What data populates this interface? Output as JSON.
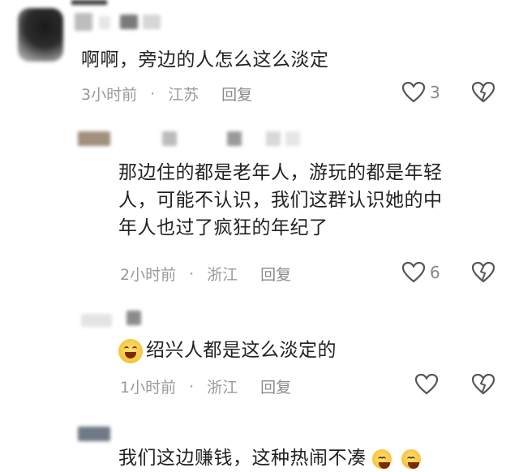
{
  "comments": [
    {
      "text": "啊啊，旁边的人怎么这么淡定",
      "time": "3小时前",
      "location": "江苏",
      "reply": "回复",
      "likes": "3"
    },
    {
      "lines": [
        "那边住的都是老年人，游玩的都是年轻",
        "人，可能不认识，我们这群认识她的中",
        "年人也过了疯狂的年纪了"
      ],
      "time": "2小时前",
      "location": "浙江",
      "reply": "回复",
      "likes": "6"
    },
    {
      "emoji": "laughing-sweat-emoji",
      "text": "绍兴人都是这么淡定的",
      "time": "1小时前",
      "location": "浙江",
      "reply": "回复",
      "likes": ""
    },
    {
      "text_partial": "我们这边赚钱，这种热闹不凑"
    }
  ],
  "separator": "·",
  "colors": {
    "text": "#222222",
    "meta": "#9a9a9a",
    "icon": "#555555"
  },
  "icons": [
    "heart-outline-icon",
    "broken-heart-icon"
  ]
}
